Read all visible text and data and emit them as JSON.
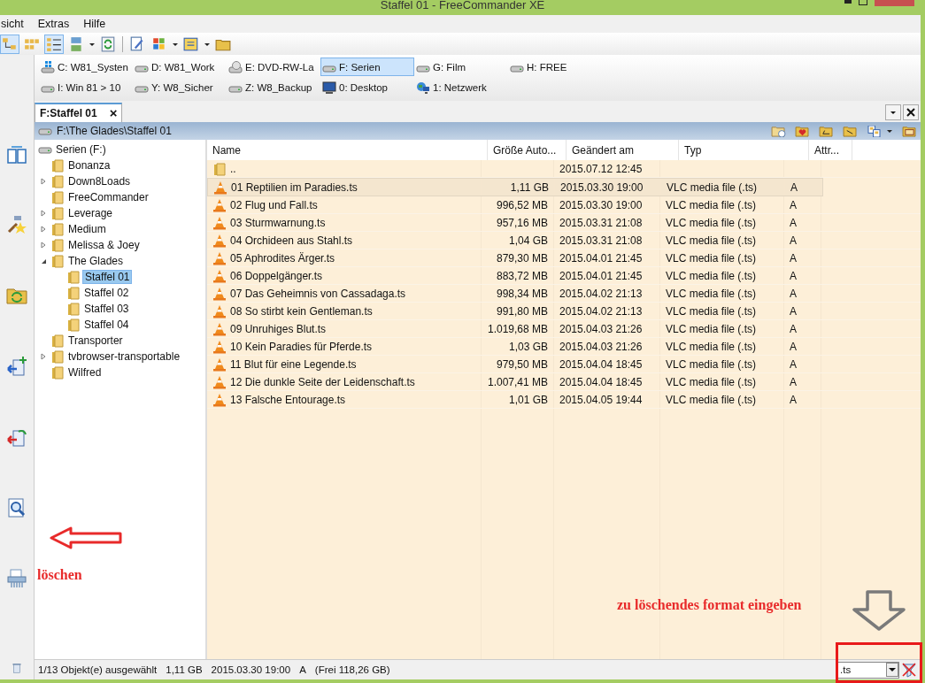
{
  "window": {
    "title": "Staffel 01 - FreeCommander XE"
  },
  "menu": [
    "sicht",
    "Extras",
    "Hilfe"
  ],
  "drives": [
    {
      "label": "C: W81_Systen",
      "kind": "windows",
      "selected": false
    },
    {
      "label": "D: W81_Work",
      "kind": "disk",
      "selected": false
    },
    {
      "label": "E: DVD-RW-La",
      "kind": "dvd",
      "selected": false
    },
    {
      "label": "F: Serien",
      "kind": "disk",
      "selected": true
    },
    {
      "label": "G: Film",
      "kind": "disk",
      "selected": false
    },
    {
      "label": "H: FREE",
      "kind": "disk",
      "selected": false
    },
    {
      "label": "I: Win 81 > 10",
      "kind": "disk",
      "selected": false
    },
    {
      "label": "Y: W8_Sicher",
      "kind": "disk",
      "selected": false
    },
    {
      "label": "Z: W8_Backup",
      "kind": "disk",
      "selected": false
    },
    {
      "label": "0: Desktop",
      "kind": "desktop",
      "selected": false
    },
    {
      "label": "1: Netzwerk",
      "kind": "network",
      "selected": false
    }
  ],
  "tab": {
    "label": "F:Staffel 01",
    "close": "×"
  },
  "path": "F:\\The Glades\\Staffel 01",
  "tree": {
    "label": "Serien (F:)",
    "children": [
      {
        "label": "Bonanza",
        "selected": false
      },
      {
        "label": "Down8Loads",
        "expanded": false,
        "selected": false
      },
      {
        "label": "FreeCommander",
        "selected": false
      },
      {
        "label": "Leverage",
        "expanded": false,
        "selected": false
      },
      {
        "label": "Medium",
        "expanded": false,
        "selected": false
      },
      {
        "label": "Melissa & Joey",
        "expanded": false,
        "selected": false
      },
      {
        "label": "The Glades",
        "expanded": true,
        "selected": false,
        "children": [
          {
            "label": "Staffel 01",
            "selected": true
          },
          {
            "label": "Staffel 02",
            "selected": false
          },
          {
            "label": "Staffel 03",
            "selected": false
          },
          {
            "label": "Staffel 04",
            "selected": false
          }
        ]
      },
      {
        "label": "Transporter",
        "selected": false
      },
      {
        "label": "tvbrowser-transportable",
        "expanded": false,
        "selected": false
      },
      {
        "label": "Wilfred",
        "selected": false
      }
    ]
  },
  "table": {
    "columns": [
      "Name",
      "Größe Auto...",
      "Geändert am",
      "Typ",
      "Attr..."
    ],
    "rows": [
      {
        "kind": "folder",
        "name": "..",
        "size": "",
        "modified": "2015.07.12 12:45",
        "type": "",
        "attr": "",
        "selected": false
      },
      {
        "kind": "video",
        "name": "01 Reptilien im Paradies.ts",
        "size": "1,11 GB",
        "modified": "2015.03.30 19:00",
        "type": "VLC media file (.ts)",
        "attr": "A",
        "selected": true
      },
      {
        "kind": "video",
        "name": "02 Flug und Fall.ts",
        "size": "996,52 MB",
        "modified": "2015.03.30 19:00",
        "type": "VLC media file (.ts)",
        "attr": "A",
        "selected": false
      },
      {
        "kind": "video",
        "name": "03 Sturmwarnung.ts",
        "size": "957,16 MB",
        "modified": "2015.03.31 21:08",
        "type": "VLC media file (.ts)",
        "attr": "A",
        "selected": false
      },
      {
        "kind": "video",
        "name": "04 Orchideen aus Stahl.ts",
        "size": "1,04 GB",
        "modified": "2015.03.31 21:08",
        "type": "VLC media file (.ts)",
        "attr": "A",
        "selected": false
      },
      {
        "kind": "video",
        "name": "05 Aphrodites Ärger.ts",
        "size": "879,30 MB",
        "modified": "2015.04.01 21:45",
        "type": "VLC media file (.ts)",
        "attr": "A",
        "selected": false
      },
      {
        "kind": "video",
        "name": "06 Doppelgänger.ts",
        "size": "883,72 MB",
        "modified": "2015.04.01 21:45",
        "type": "VLC media file (.ts)",
        "attr": "A",
        "selected": false
      },
      {
        "kind": "video",
        "name": "07 Das Geheimnis von Cassadaga.ts",
        "size": "998,34 MB",
        "modified": "2015.04.02 21:13",
        "type": "VLC media file (.ts)",
        "attr": "A",
        "selected": false
      },
      {
        "kind": "video",
        "name": "08 So stirbt kein Gentleman.ts",
        "size": "991,80 MB",
        "modified": "2015.04.02 21:13",
        "type": "VLC media file (.ts)",
        "attr": "A",
        "selected": false
      },
      {
        "kind": "video",
        "name": "09 Unruhiges Blut.ts",
        "size": "1.019,68 MB",
        "modified": "2015.04.03 21:26",
        "type": "VLC media file (.ts)",
        "attr": "A",
        "selected": false
      },
      {
        "kind": "video",
        "name": "10 Kein Paradies für Pferde.ts",
        "size": "1,03 GB",
        "modified": "2015.04.03 21:26",
        "type": "VLC media file (.ts)",
        "attr": "A",
        "selected": false
      },
      {
        "kind": "video",
        "name": "11 Blut für eine Legende.ts",
        "size": "979,50 MB",
        "modified": "2015.04.04 18:45",
        "type": "VLC media file (.ts)",
        "attr": "A",
        "selected": false
      },
      {
        "kind": "video",
        "name": "12 Die dunkle Seite der Leidenschaft.ts",
        "size": "1.007,41 MB",
        "modified": "2015.04.04 18:45",
        "type": "VLC media file (.ts)",
        "attr": "A",
        "selected": false
      },
      {
        "kind": "video",
        "name": "13 Falsche Entourage.ts",
        "size": "1,01 GB",
        "modified": "2015.04.05 19:44",
        "type": "VLC media file (.ts)",
        "attr": "A",
        "selected": false
      }
    ]
  },
  "status_bar": [
    "1/13 Objekt(e) ausgewählt",
    "1,11 GB",
    "2015.03.30 19:00",
    "A",
    "(Frei 118,26 GB)"
  ],
  "filter": {
    "value": ".ts"
  },
  "annotations": {
    "delete_label": "löschen",
    "format_label": "zu löschendes format eingeben"
  }
}
